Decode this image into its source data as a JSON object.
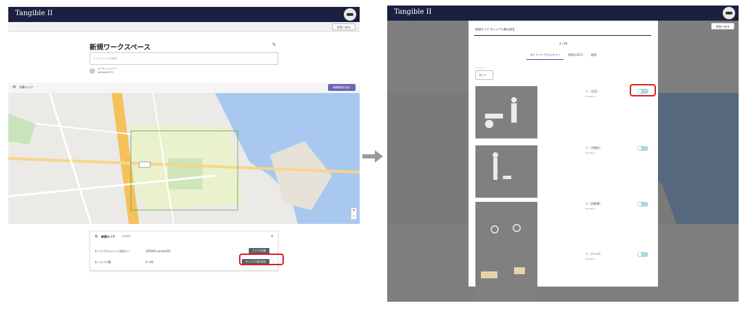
{
  "app": {
    "title": "Tangible II"
  },
  "left": {
    "back_label": "前頁へ戻る",
    "workspace_title": "新規ワークスペース",
    "workspace_desc_placeholder": "ワークスペースの説明",
    "owner_label": "オーナーメンバー",
    "owner_name": "platoon2023",
    "area_section_label": "対象エリア",
    "area_select_button": "範囲範囲を追加",
    "card": {
      "name": "新規エリア",
      "scale": "1/2000",
      "row1_label": "タンジブルユニット送信キー",
      "row1_value": "100300.sample02",
      "row2_label": "タンジブル数",
      "row2_value": "0 / 99",
      "area_button": "エリアの変更",
      "tangible_button": "タンジブル数を設定"
    }
  },
  "right": {
    "modal_title": "新規エリア タンジブル数の設定",
    "counter": "0 / 99",
    "tabs": [
      "ストリートファニチャー",
      "建物(LOD1)",
      "植栽"
    ],
    "filter_label": "フィルタ",
    "filter_value": "なし",
    "items": [
      {
        "name": "人（立生）",
        "category": "Furniture"
      },
      {
        "name": "人（犬連れ）",
        "category": "Furniture"
      },
      {
        "name": "人（自転車）",
        "category": "Furniture"
      },
      {
        "name": "人（ベンチ）",
        "category": "Furniture"
      }
    ],
    "area_select_button": "範囲範囲を追加"
  },
  "colors": {
    "header": "#1b2041",
    "accent": "#6e63b4",
    "highlight": "#e21b1b",
    "toggle": "#a9d9df"
  }
}
